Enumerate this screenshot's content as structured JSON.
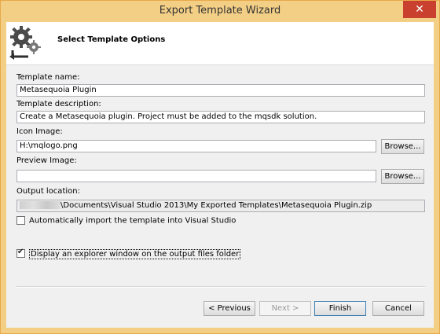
{
  "window": {
    "title": "Export Template Wizard",
    "close_symbol": "✕"
  },
  "header": {
    "section_title": "Select Template Options",
    "icon": "gear-with-arrow-icon"
  },
  "fields": {
    "template_name": {
      "label": "Template name:",
      "value": "Metasequoia Plugin"
    },
    "template_description": {
      "label": "Template description:",
      "value": "Create a Metasequoia plugin. Project must be added to the mqsdk solution."
    },
    "icon_image": {
      "label": "Icon Image:",
      "value": "H:\\mqlogo.png",
      "browse": "Browse..."
    },
    "preview_image": {
      "label": "Preview Image:",
      "value": "",
      "browse": "Browse..."
    },
    "output_location": {
      "label": "Output location:",
      "value": "\\Documents\\Visual Studio 2013\\My Exported Templates\\Metasequoia Plugin.zip"
    }
  },
  "options": {
    "auto_import": {
      "label": "Automatically import the template into Visual Studio",
      "checked": false
    },
    "explorer_window": {
      "label": "Display an explorer window on the output files folder",
      "checked": true
    }
  },
  "buttons": {
    "previous": "< Previous",
    "next": "Next >",
    "finish": "Finish",
    "cancel": "Cancel"
  }
}
